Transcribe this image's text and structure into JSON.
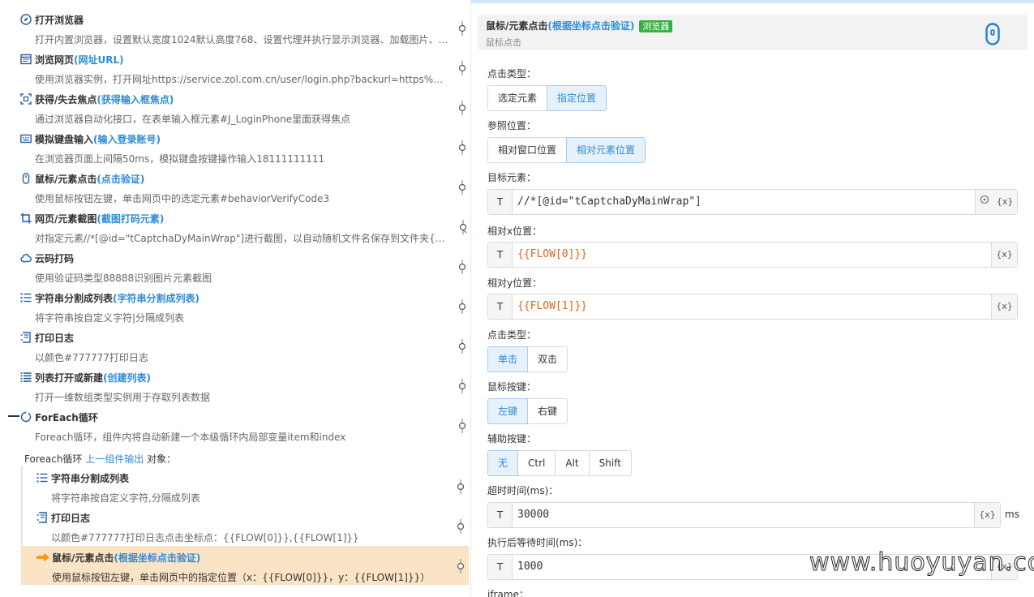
{
  "flow": {
    "items": [
      {
        "title": "打开浏览器",
        "sub": "",
        "desc": "打开内置浏览器，设置默认宽度1024默认高度768、设置代理并执行显示浏览器、加载图片、…"
      },
      {
        "title": "浏览网页",
        "sub": "(网址URL)",
        "desc": "使用浏览器实例，打开网址https://service.zol.com.cn/user/login.php?backurl=https%3A%2F%…"
      },
      {
        "title": "获得/失去焦点",
        "sub": "(获得输入框焦点)",
        "desc": "通过浏览器自动化接口，在表单输入框元素#J_LoginPhone里面获得焦点"
      },
      {
        "title": "模拟键盘输入",
        "sub": "(输入登录账号)",
        "desc": "在浏览器页面上间隔50ms，模拟键盘按键操作输入18111111111"
      },
      {
        "title": "鼠标/元素点击",
        "sub": "(点击验证)",
        "desc": "使用鼠标按钮左键，单击网页中的选定元素#behaviorVerifyCode3"
      },
      {
        "title": "网页/元素截图",
        "sub": "(截图打码元素)",
        "desc": "对指定元素//*[@id=\"tCaptchaDyMainWrap\"]进行截图，以自动随机文件名保存到文件夹{{ENV…"
      },
      {
        "title": "云码打码",
        "sub": "",
        "desc": "使用验证码类型88888识别图片元素截图"
      },
      {
        "title": "字符串分割成列表",
        "sub": "(字符串分割成列表)",
        "desc": "将字符串按自定义字符|分隔成列表"
      },
      {
        "title": "打印日志",
        "sub": "",
        "desc": "以颜色#777777打印日志"
      },
      {
        "title": "列表打开或新建",
        "sub": "(创建列表)",
        "desc": "打开一维数组类型实例用于存取列表数据"
      },
      {
        "title": "ForEach循环",
        "sub": "",
        "desc": "Foreach循环，组件内将自动新建一个本级循环内局部变量item和index"
      }
    ],
    "foreach_label": {
      "prefix": "Foreach循环",
      "link": "上一组件输出",
      "suffix": "对象："
    },
    "nested": [
      {
        "title": "字符串分割成列表",
        "sub": "",
        "desc": "将字符串按自定义字符,分隔成列表"
      },
      {
        "title": "打印日志",
        "sub": "",
        "desc": "以颜色#777777打印日志点击坐标点：{{FLOW[0]}},{{FLOW[1]}}"
      },
      {
        "title": "鼠标/元素点击",
        "sub": "(根据坐标点击验证)",
        "desc": "使用鼠标按钮左键，单击网页中的指定位置（x：{{FLOW[0]}}，y：{{FLOW[1]}}）"
      }
    ]
  },
  "panel": {
    "title": "鼠标/元素点击",
    "title_sub": "(根据坐标点击验证)",
    "badge": "浏览器",
    "subtitle": "鼠标点击",
    "click_type_label": "点击类型：",
    "click_type_opts": [
      "选定元素",
      "指定位置"
    ],
    "ref_label": "参照位置：",
    "ref_opts": [
      "相对窗口位置",
      "相对元素位置"
    ],
    "target_label": "目标元素：",
    "target_value": "//*[@id=\"tCaptchaDyMainWrap\"]",
    "relx_label": "相对x位置：",
    "relx_value": "{{FLOW[0]}}",
    "rely_label": "相对y位置：",
    "rely_value": "{{FLOW[1]}}",
    "click_kind_label": "点击类型：",
    "click_kind_opts": [
      "单击",
      "双击"
    ],
    "mouse_btn_label": "鼠标按键：",
    "mouse_btn_opts": [
      "左键",
      "右键"
    ],
    "aux_label": "辅助按键：",
    "aux_opts": [
      "无",
      "Ctrl",
      "Alt",
      "Shift"
    ],
    "timeout_label": "超时时间(ms)：",
    "timeout_value": "30000",
    "timeout_unit": "ms",
    "wait_label": "执行后等待时间(ms)：",
    "wait_value": "1000",
    "iframe_label": "iframe：",
    "t_label": "T",
    "var_btn": "{x}"
  },
  "watermark": "www.huoyuyan.com"
}
